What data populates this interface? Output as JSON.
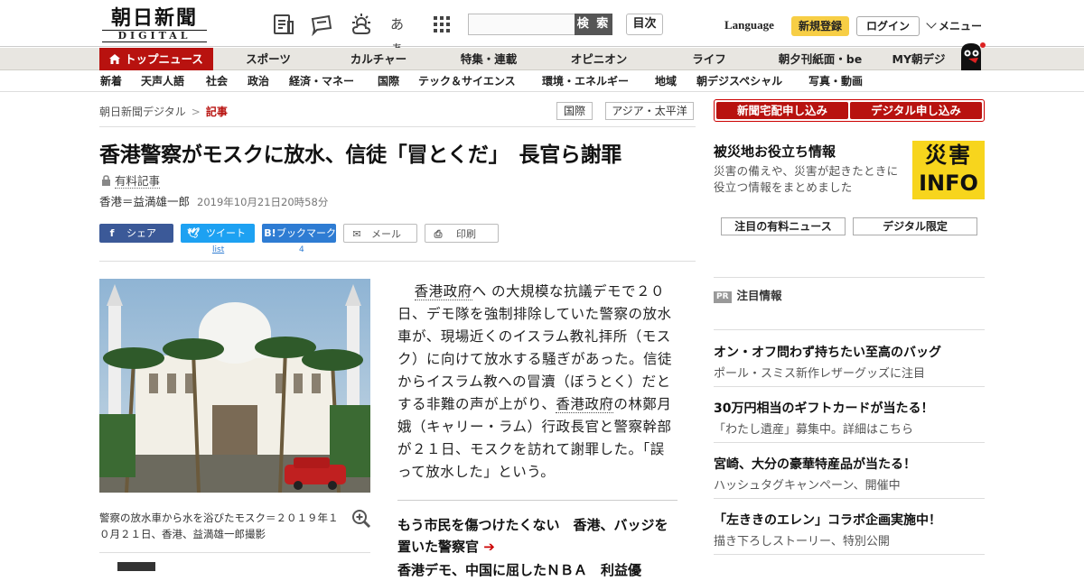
{
  "header": {
    "logo_jp": "朝日新聞",
    "logo_en": "DIGITAL",
    "search_button": "検 索",
    "toc_button": "目次",
    "language": "Language",
    "signup": "新規登録",
    "login": "ログイン",
    "menu": "メニュー",
    "icons": [
      "newspaper-icon",
      "message-icon",
      "weather-icon",
      "font-size-icon",
      "grid-icon"
    ],
    "font_icon_text": "あぁ"
  },
  "nav_primary": [
    "トップニュース",
    "スポーツ",
    "カルチャー",
    "特集・連載",
    "オピニオン",
    "ライフ",
    "朝夕刊紙面・be",
    "MY朝デジ"
  ],
  "nav_secondary": [
    "新着",
    "天声人語",
    "社会",
    "政治",
    "経済・マネー",
    "国際",
    "テック＆サイエンス",
    "環境・エネルギー",
    "地域",
    "朝デジスペシャル",
    "写真・動画"
  ],
  "breadcrumb": {
    "home": "朝日新聞デジタル",
    "separator": ">",
    "current": "記事"
  },
  "tags": [
    "国際",
    "アジア・太平洋"
  ],
  "article": {
    "title": "香港警察がモスクに放水、信徒「冒とくだ」　長官ら謝罪",
    "paid_label": "有料記事",
    "author": "香港＝益満雄一郎",
    "date": "2019年10月21日20時58分",
    "body_p1": "へ の大規模な抗議デモで２０日、デモ隊を強制排除していた警察の放水車が、現場近くのイスラム教礼拝所（モスク）に向けて放水する騒ぎがあった。信徒からイスラム教への冒瀆（ぼうとく）だとする非難の声が上がり、",
    "keyword1": "香港政府",
    "keyword2": "香港政府",
    "body_p2": "の林鄭月娥（キャリー・ラム）行政長官と警察幹部が２１日、モスクを訪れて謝罪した。「誤って放水した」という。",
    "caption": "警察の放水車から水を浴びたモスク＝２０１９年１０月２１日、香港、益満雄一郎撮影",
    "related1": "もう市民を傷つけたくない　香港、バッジを置いた警察官",
    "related2": "香港デモ、中国に屈したＮＢＡ　利益優"
  },
  "share": {
    "facebook": "シェア",
    "twitter": "ツイート",
    "twitter_count": "list",
    "hatena": "ブックマーク",
    "hatena_count": "4",
    "mail": "メール",
    "print": "印刷"
  },
  "sidebar": {
    "home_delivery": "新聞宅配申し込み",
    "digital_signup": "デジタル申し込み",
    "disaster_title": "被災地お役立ち情報",
    "disaster_desc": "災害の備えや、災害が起きたときに役立つ情報をまとめました",
    "disaster_logo_top": "災害",
    "disaster_logo_bottom": "INFO",
    "paid_news_btn": "注目の有料ニュース",
    "digital_only_btn": "デジタル限定",
    "pr_badge": "PR",
    "pr_heading": "注目情報",
    "pr_items": [
      {
        "title": "オン・オフ問わず持ちたい至高のバッグ",
        "sub": "ポール・スミス新作レザーグッズに注目"
      },
      {
        "title": "30万円相当のギフトカードが当たる！",
        "sub": "「わたし遺産」募集中。詳細はこちら"
      },
      {
        "title": "宮崎、大分の豪華特産品が当たる！",
        "sub": "ハッシュタグキャンペーン、開催中"
      },
      {
        "title": "「左ききのエレン」コラボ企画実施中！",
        "sub": "描き下ろしストーリー、特別公開"
      }
    ]
  },
  "colors": {
    "brand_red": "#b8120f",
    "signup_yellow": "#f7ce45",
    "facebook": "#3b5998",
    "twitter": "#1da1f2",
    "hatena": "#2e7cd3"
  }
}
